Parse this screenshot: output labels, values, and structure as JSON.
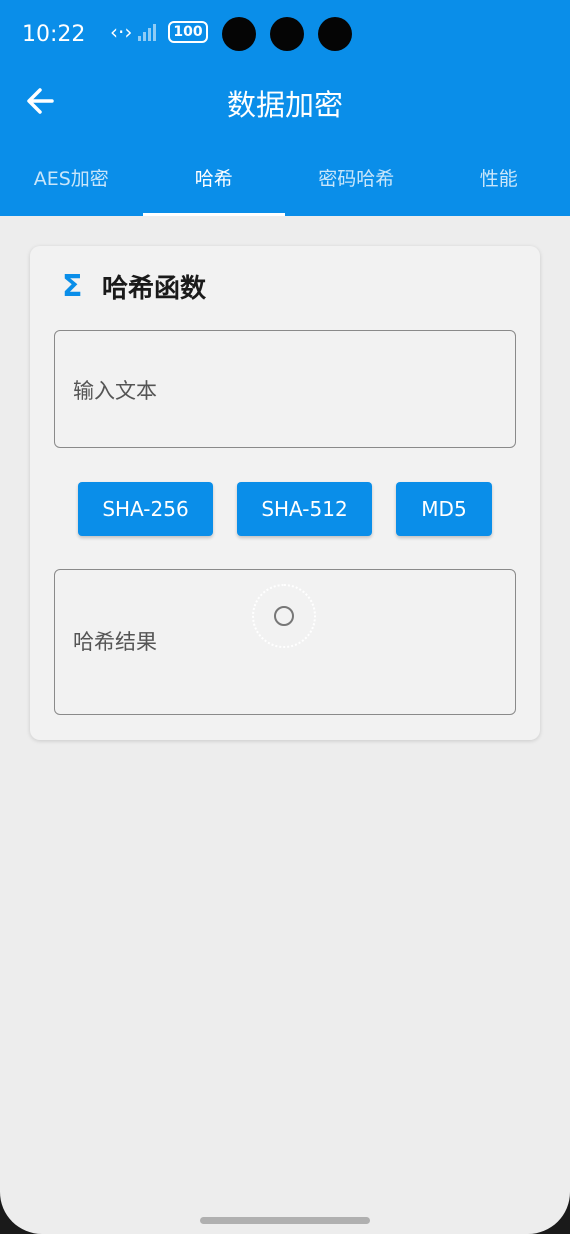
{
  "status_bar": {
    "time": "10:22",
    "battery": "100"
  },
  "app_bar": {
    "title": "数据加密"
  },
  "tabs": [
    {
      "label": "AES加密"
    },
    {
      "label": "哈希"
    },
    {
      "label": "密码哈希"
    },
    {
      "label": "性能"
    }
  ],
  "active_tab": 1,
  "card": {
    "title": "哈希函数",
    "icon": "sigma-icon",
    "input_label": "输入文本",
    "result_label": "哈希结果"
  },
  "buttons": [
    {
      "label": "SHA-256"
    },
    {
      "label": "SHA-512"
    },
    {
      "label": "MD5"
    }
  ],
  "colors": {
    "primary": "#0a8ee9",
    "background": "#ededed",
    "card": "#f2f2f2"
  }
}
